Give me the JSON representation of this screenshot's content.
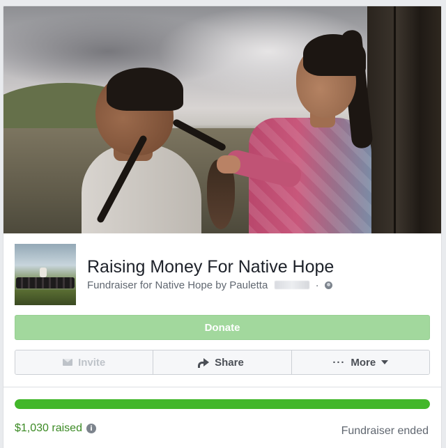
{
  "fundraiser": {
    "title": "Raising Money For Native Hope",
    "subtitle_prefix": "Fundraiser for Native Hope by Pauletta",
    "subtitle_sep": "·",
    "privacy_icon": "globe-icon",
    "cover_image": "man-having-hair-braided-by-girl-outdoors",
    "thumbnail_image": "horses-and-rider-on-prairie"
  },
  "buttons": {
    "donate": "Donate",
    "invite": "Invite",
    "share": "Share",
    "more": "More",
    "more_dots": "···"
  },
  "icons": {
    "invite": "envelope-icon",
    "share": "share-arrow-icon",
    "more": "chevron-down-icon",
    "info": "info-icon"
  },
  "progress": {
    "fraction": 1.0,
    "raised_label": "$1,030 raised",
    "info_glyph": "i",
    "status": "Fundraiser ended"
  },
  "colors": {
    "donate_bg": "#a2d89d",
    "progress_fill": "#42b72a",
    "raised_text": "#3b8a24",
    "title_text": "#1d2129",
    "muted_text": "#606770"
  }
}
